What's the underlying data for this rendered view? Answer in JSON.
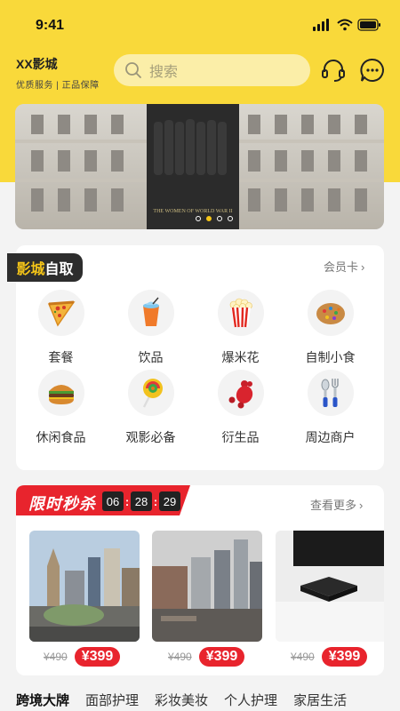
{
  "status": {
    "time": "9:41"
  },
  "header": {
    "store_name": "XX影城",
    "tagline": "优质服务 | 正品保障",
    "search_placeholder": "搜索"
  },
  "banner": {
    "caption": "THE WOMEN OF WORLD WAR II",
    "dots": 4,
    "active_dot": 2
  },
  "category": {
    "badge_highlight": "影城",
    "badge_text": "自取",
    "member_link": "会员卡",
    "items": [
      {
        "label": "套餐",
        "icon": "pizza-icon"
      },
      {
        "label": "饮品",
        "icon": "drink-icon"
      },
      {
        "label": "爆米花",
        "icon": "popcorn-icon"
      },
      {
        "label": "自制小食",
        "icon": "cookie-icon"
      },
      {
        "label": "休闲食品",
        "icon": "burger-icon"
      },
      {
        "label": "观影必备",
        "icon": "lollipop-icon"
      },
      {
        "label": "衍生品",
        "icon": "gummy-bear-icon"
      },
      {
        "label": "周边商户",
        "icon": "cutlery-icon"
      }
    ]
  },
  "flash_sale": {
    "title": "限时秒杀",
    "timer": {
      "h": "06",
      "m": "28",
      "s": "29"
    },
    "more_link": "查看更多",
    "products": [
      {
        "old_price": "¥490",
        "price": "¥399"
      },
      {
        "old_price": "¥490",
        "price": "¥399"
      },
      {
        "old_price": "¥490",
        "price": "¥399"
      }
    ]
  },
  "tabs": [
    "跨境大牌",
    "面部护理",
    "彩妆美妆",
    "个人护理",
    "家居生活"
  ],
  "colors": {
    "brand_yellow": "#f9d93a",
    "sale_red": "#e8242d",
    "dark": "#2d2d2d"
  }
}
